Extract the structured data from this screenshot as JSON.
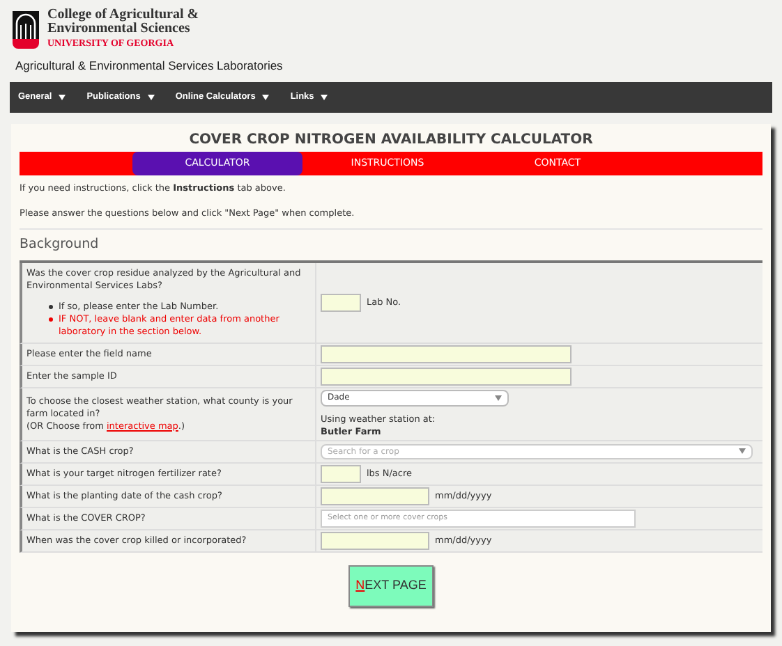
{
  "header": {
    "college": [
      "College of Agricultural &",
      "Environmental Sciences"
    ],
    "university": "UNIVERSITY OF GEORGIA",
    "lab_title": "Agricultural & Environmental Services Laboratories"
  },
  "nav": [
    "General",
    "Publications",
    "Online Calculators",
    "Links"
  ],
  "title": "COVER CROP NITROGEN AVAILABILITY CALCULATOR",
  "tabs": [
    {
      "label": "CALCULATOR",
      "selected": true
    },
    {
      "label": "INSTRUCTIONS",
      "selected": false
    },
    {
      "label": "CONTACT",
      "selected": false
    }
  ],
  "intro": [
    "If you need instructions, click the **Instructions** tab above.",
    "Please answer the questions below and click \"Next Page\" when complete."
  ],
  "section": "Background",
  "rows": [
    {
      "kind": "lab",
      "question": "Was the cover crop residue analyzed by the Agricultural and Environmental Services Labs?",
      "bullets": [
        {
          "text": "If so, please enter the Lab Number.",
          "warning": false
        },
        {
          "text": "IF NOT, leave blank and enter data from another laboratory in the section below.",
          "warning": true
        }
      ],
      "unit": "Lab No."
    },
    {
      "kind": "text",
      "question": "Please enter the field name"
    },
    {
      "kind": "text",
      "question": "Enter the sample ID"
    },
    {
      "kind": "county",
      "question": "To choose the closest weather station, what county is your farm located in?",
      "note_before": "(OR Choose from ",
      "link": "interactive map",
      "note_after": ".)",
      "value": "Dade",
      "station_label": "Using weather station at:",
      "station": "Butler Farm"
    },
    {
      "kind": "select",
      "question": "What is the CASH crop?",
      "placeholder": "Search for a crop"
    },
    {
      "kind": "short",
      "question": "What is your target nitrogen fertilizer rate?",
      "unit": "lbs N/acre"
    },
    {
      "kind": "date",
      "question": "What is the planting date of the cash crop?",
      "unit": "mm/dd/yyyy"
    },
    {
      "kind": "multi",
      "question": "What is the COVER CROP?",
      "placeholder": "Select one or more cover crops"
    },
    {
      "kind": "date",
      "question": "When was the cover crop killed or incorporated?",
      "unit": "mm/dd/yyyy"
    }
  ],
  "button": "NEXT PAGE"
}
